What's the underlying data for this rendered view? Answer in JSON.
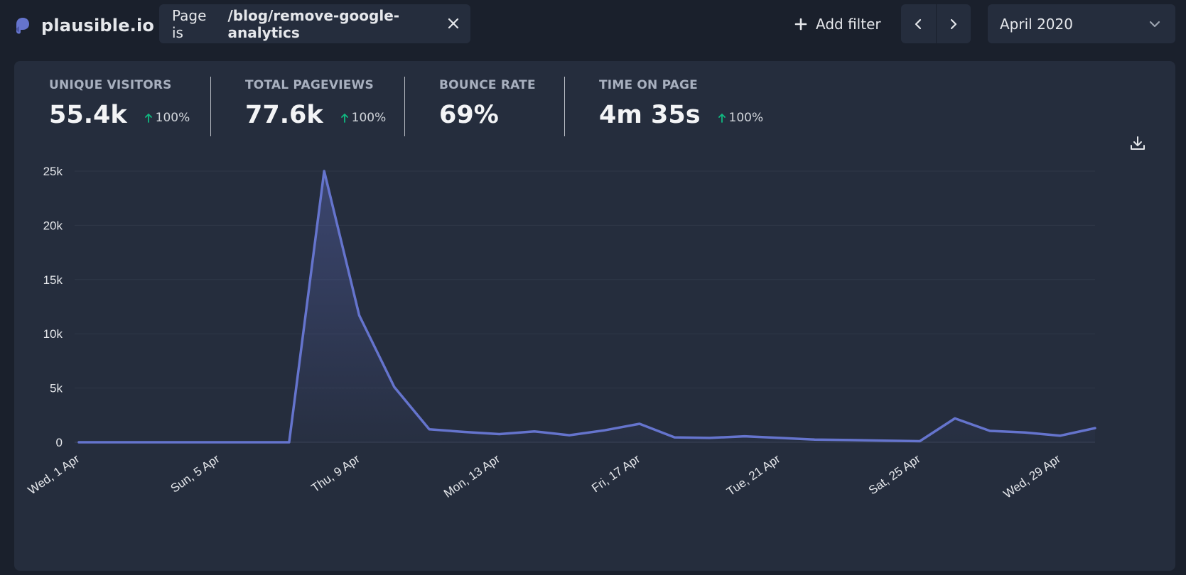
{
  "app": {
    "name": "plausible.io",
    "logo_icon": "plausible-logo-icon",
    "brand_color": "#6574cd"
  },
  "filter": {
    "prefix": "Page is",
    "value": "/blog/remove-google-analytics",
    "close_icon": "close-icon"
  },
  "toolbar": {
    "add_filter_label": "Add filter",
    "prev_icon": "chevron-left-icon",
    "next_icon": "chevron-right-icon",
    "date_range": "April 2020",
    "date_dropdown_icon": "chevron-down-icon",
    "download_icon": "download-icon"
  },
  "stats": [
    {
      "label": "UNIQUE VISITORS",
      "value": "55.4k",
      "change": "100%"
    },
    {
      "label": "TOTAL PAGEVIEWS",
      "value": "77.6k",
      "change": "100%"
    },
    {
      "label": "BOUNCE RATE",
      "value": "69%",
      "change": ""
    },
    {
      "label": "TIME ON PAGE",
      "value": "4m 35s",
      "change": "100%"
    }
  ],
  "colors": {
    "background": "#1a202c",
    "panel": "#252d3d",
    "line": "#6574cd",
    "positive_change": "#10b981"
  },
  "chart_data": {
    "type": "area",
    "title": "",
    "xlabel": "",
    "ylabel": "",
    "x": [
      "2020-04-01",
      "2020-04-02",
      "2020-04-03",
      "2020-04-04",
      "2020-04-05",
      "2020-04-06",
      "2020-04-07",
      "2020-04-08",
      "2020-04-09",
      "2020-04-10",
      "2020-04-11",
      "2020-04-12",
      "2020-04-13",
      "2020-04-14",
      "2020-04-15",
      "2020-04-16",
      "2020-04-17",
      "2020-04-18",
      "2020-04-19",
      "2020-04-20",
      "2020-04-21",
      "2020-04-22",
      "2020-04-23",
      "2020-04-24",
      "2020-04-25",
      "2020-04-26",
      "2020-04-27",
      "2020-04-28",
      "2020-04-29",
      "2020-04-30"
    ],
    "x_tick_labels": [
      "Wed, 1 Apr",
      "Sun, 5 Apr",
      "Thu, 9 Apr",
      "Mon, 13 Apr",
      "Fri, 17 Apr",
      "Tue, 21 Apr",
      "Sat, 25 Apr",
      "Wed, 29 Apr"
    ],
    "x_tick_dates": [
      "2020-04-01",
      "2020-04-05",
      "2020-04-09",
      "2020-04-13",
      "2020-04-17",
      "2020-04-21",
      "2020-04-25",
      "2020-04-29"
    ],
    "values": [
      0,
      0,
      0,
      0,
      0,
      0,
      0,
      25000,
      11700,
      5100,
      1200,
      950,
      750,
      1000,
      650,
      1100,
      1700,
      450,
      400,
      550,
      400,
      250,
      200,
      150,
      100,
      2200,
      1050,
      900,
      600,
      1300
    ],
    "y_ticks": [
      0,
      5000,
      10000,
      15000,
      20000,
      25000
    ],
    "y_tick_labels": [
      "0",
      "5k",
      "10k",
      "15k",
      "20k",
      "25k"
    ],
    "ylim": [
      0,
      25000
    ],
    "grid": true
  }
}
